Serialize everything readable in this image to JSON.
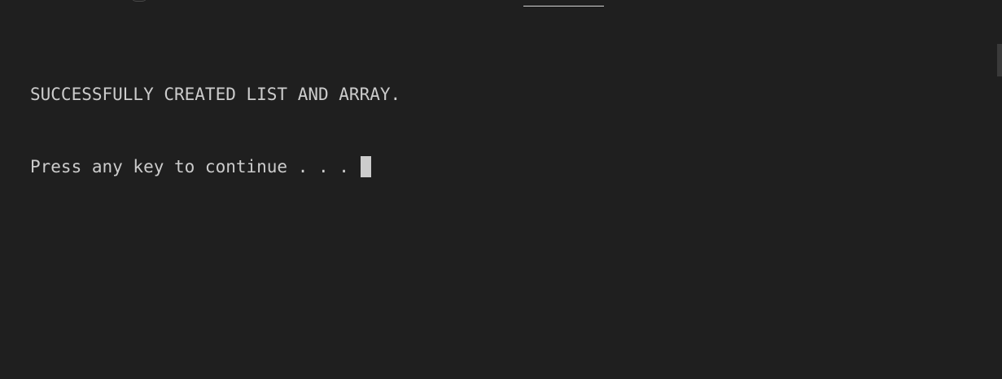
{
  "console": {
    "lines": [
      "SUCCESSFULLY CREATED LIST AND ARRAY.",
      "Press any key to continue . . . "
    ]
  }
}
